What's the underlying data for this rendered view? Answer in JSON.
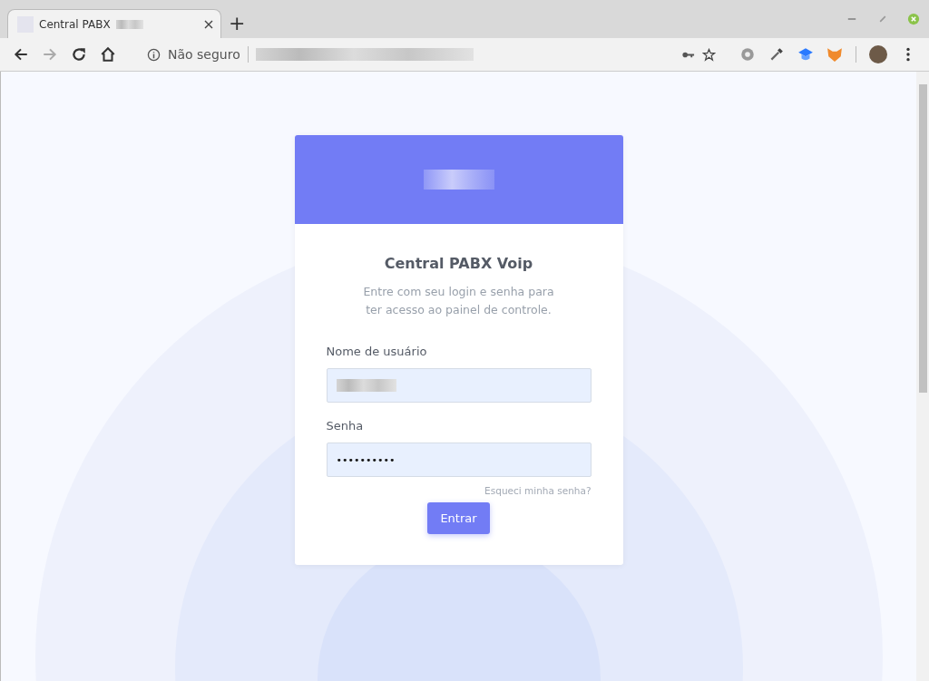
{
  "browser": {
    "tab": {
      "title": "Central PABX"
    },
    "new_tab": "+",
    "address": {
      "security": "Não seguro"
    }
  },
  "login": {
    "title": "Central PABX Voip",
    "subtitle": "Entre com seu login e senha para ter acesso ao painel de controle.",
    "fields": [
      {
        "kind": "text",
        "label": "Nome de usuário"
      },
      {
        "kind": "password",
        "label": "Senha",
        "value": "••••••••••"
      }
    ],
    "forgot_link": "Esqueci minha senha?",
    "submit": "Entrar"
  }
}
